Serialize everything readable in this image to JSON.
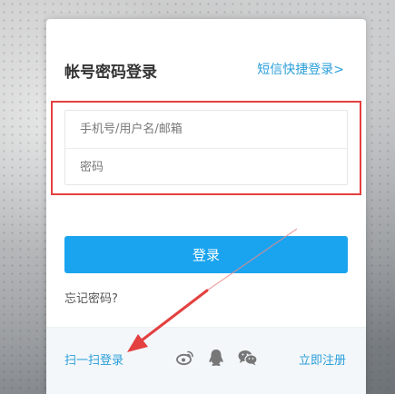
{
  "login": {
    "title": "帐号密码登录",
    "sms_link": "短信快捷登录>",
    "username_placeholder": "手机号/用户名/邮箱",
    "password_placeholder": "密码",
    "submit_label": "登录",
    "forgot_link": "忘记密码?"
  },
  "footer": {
    "scan_link": "扫一扫登录",
    "register_link": "立即注册",
    "social_icons": [
      "weibo-icon",
      "qq-icon",
      "wechat-icon"
    ]
  },
  "colors": {
    "accent": "#1aa4f0",
    "link": "#2b9fd9",
    "annotation": "#e3403f"
  }
}
